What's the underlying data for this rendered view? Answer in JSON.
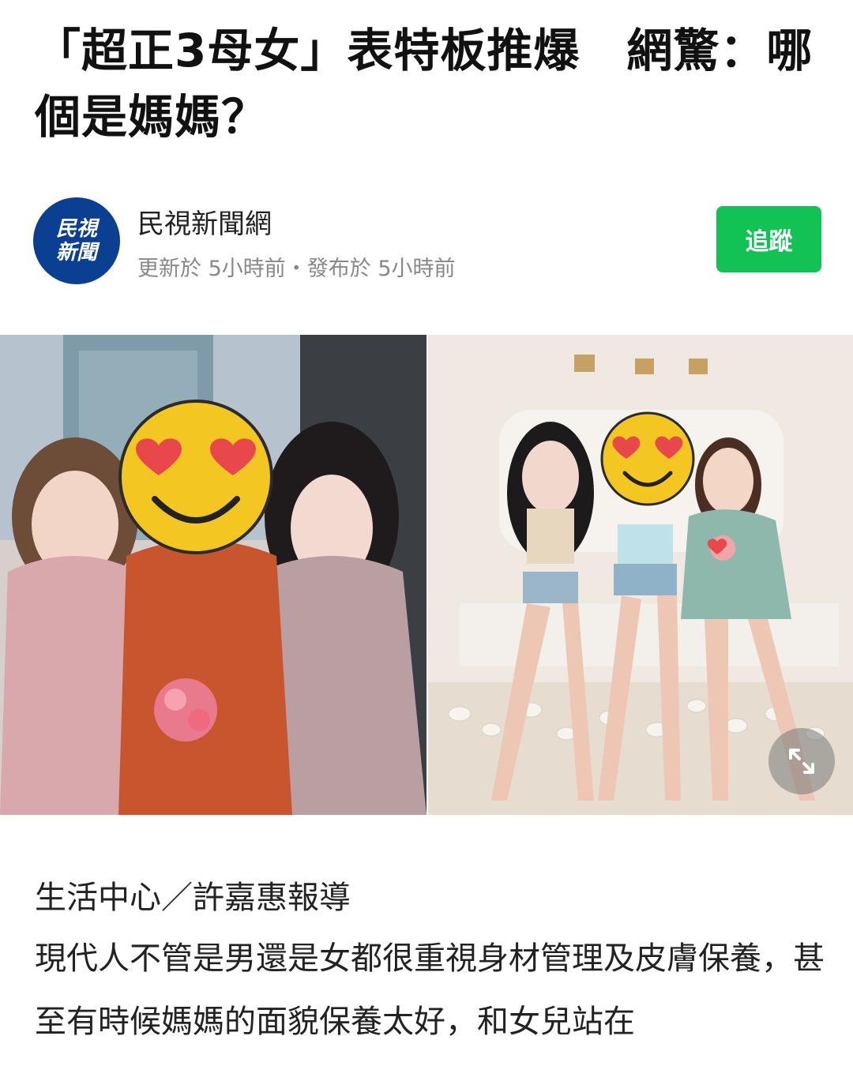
{
  "article": {
    "title": "「超正3母女」表特板推爆　網驚：哪個是媽媽？",
    "byline": "生活中心／許嘉惠報導",
    "body": "現代人不管是男還是女都很重視身材管理及皮膚保養，甚至有時候媽媽的面貌保養太好，和女兒站在"
  },
  "source": {
    "logo_line1": "民視",
    "logo_line2": "新聞",
    "name": "民視新聞網",
    "meta": "更新於 5小時前・發布於 5小時前",
    "follow_label": "追蹤"
  },
  "colors": {
    "follow_green": "#12c255",
    "logo_blue": "#0b3f91"
  },
  "icons": {
    "expand": "expand-arrows-icon",
    "emoji": "heart-eyes-emoji-icon"
  }
}
